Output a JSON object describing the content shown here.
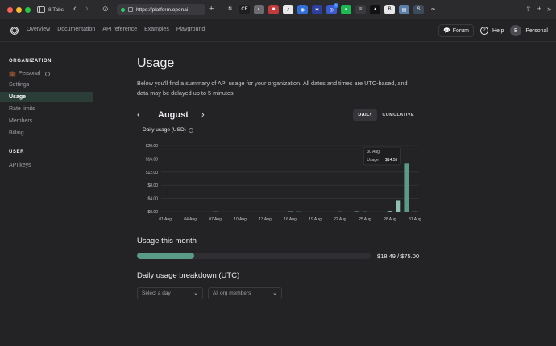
{
  "browser": {
    "tabs_label": "8 Tabs",
    "address": "https://platform.openai",
    "traffic_lights": [
      "#ff5f57",
      "#febc2e",
      "#28c840"
    ],
    "favicons": [
      {
        "name": "ni-favicon",
        "color": "#2b2b2e",
        "glyph": "N"
      },
      {
        "name": "ce-favicon",
        "color": "#1e1e20",
        "glyph": "CE"
      },
      {
        "name": "gray-favicon",
        "color": "#6b6b70",
        "glyph": "◐"
      },
      {
        "name": "red-favicon",
        "color": "#c23b3b",
        "glyph": "■"
      },
      {
        "name": "check-favicon",
        "color": "#e8e8ea",
        "glyph": "✓"
      },
      {
        "name": "blue-favicon",
        "color": "#2f6fd6",
        "glyph": "◉"
      },
      {
        "name": "spinner-favicon",
        "color": "#2c3e9e",
        "glyph": "✱"
      },
      {
        "name": "badge-favicon",
        "color": "#3a5bd0",
        "glyph": "◎",
        "badge": "1"
      },
      {
        "name": "green-favicon",
        "color": "#1db954",
        "glyph": "●"
      },
      {
        "name": "bars-favicon",
        "color": "#3a3a3e",
        "glyph": "≡"
      },
      {
        "name": "dark-favicon",
        "color": "#111111",
        "glyph": "▲"
      },
      {
        "name": "b-favicon",
        "color": "#e8e8ea",
        "glyph": "B"
      },
      {
        "name": "panel-favicon",
        "color": "#5a7fa8",
        "glyph": "▤"
      },
      {
        "name": "s-favicon",
        "color": "#3d4a5c",
        "glyph": "S"
      },
      {
        "name": "glasses-favicon",
        "color": "#2b2b2e",
        "glyph": "∞"
      }
    ]
  },
  "topnav": {
    "links": [
      "Overview",
      "Documentation",
      "API reference",
      "Examples",
      "Playground"
    ],
    "forum": "Forum",
    "help": "Help",
    "avatar_initial": "B",
    "account": "Personal"
  },
  "sidebar": {
    "org_heading": "ORGANIZATION",
    "org_name": "Personal",
    "items": [
      "Settings",
      "Usage",
      "Rate limits",
      "Members",
      "Billing"
    ],
    "active_index": 1,
    "user_heading": "USER",
    "user_items": [
      "API keys"
    ]
  },
  "main": {
    "title": "Usage",
    "description": "Below you'll find a summary of API usage for your organization. All dates and times are UTC-based, and data may be delayed up to 5 minutes.",
    "month": "August",
    "toggle": [
      "DAILY",
      "CUMULATIVE"
    ],
    "chart_label": "Daily usage (USD)",
    "usage_section": "Usage this month",
    "usage_amount": "$18.49 / $75.00",
    "usage_fraction": 0.2465,
    "breakdown_section": "Daily usage breakdown (UTC)",
    "select_day": "Select a day",
    "select_members": "All org members"
  },
  "colors": {
    "accent": "#5b9a84",
    "accent_light": "#8fbfae",
    "active_bg": "#2a3d37"
  },
  "chart_data": {
    "type": "bar",
    "title": "Daily usage (USD)",
    "y_ticks": [
      "$20.00",
      "$16.00",
      "$12.00",
      "$8.00",
      "$4.00",
      "$0.00"
    ],
    "ylim": [
      0,
      20
    ],
    "x_tick_labels": [
      "01 Aug",
      "04 Aug",
      "07 Aug",
      "10 Aug",
      "13 Aug",
      "16 Aug",
      "19 Aug",
      "22 Aug",
      "25 Aug",
      "28 Aug",
      "31 Aug"
    ],
    "categories": [
      "01 Aug",
      "02 Aug",
      "03 Aug",
      "04 Aug",
      "05 Aug",
      "06 Aug",
      "07 Aug",
      "08 Aug",
      "09 Aug",
      "10 Aug",
      "11 Aug",
      "12 Aug",
      "13 Aug",
      "14 Aug",
      "15 Aug",
      "16 Aug",
      "17 Aug",
      "18 Aug",
      "19 Aug",
      "20 Aug",
      "21 Aug",
      "22 Aug",
      "23 Aug",
      "24 Aug",
      "25 Aug",
      "26 Aug",
      "27 Aug",
      "28 Aug",
      "29 Aug",
      "30 Aug",
      "31 Aug"
    ],
    "values": [
      0,
      0,
      0,
      0,
      0,
      0,
      0.05,
      0,
      0,
      0,
      0,
      0,
      0,
      0,
      0,
      0.1,
      0.05,
      0,
      0,
      0,
      0,
      0.05,
      0,
      0.1,
      0.05,
      0,
      0,
      0.2,
      3.3,
      14.55,
      0.05
    ],
    "tooltip": {
      "date": "30 Aug",
      "label": "Usage",
      "value": "$14.55"
    }
  }
}
